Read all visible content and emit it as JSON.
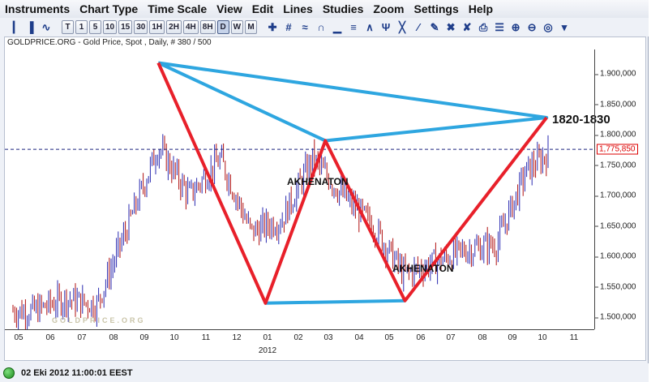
{
  "menu": [
    "Instruments",
    "Chart Type",
    "Time Scale",
    "View",
    "Edit",
    "Lines",
    "Studies",
    "Zoom",
    "Settings",
    "Help"
  ],
  "toolbar": {
    "timeframes": [
      "T",
      "1",
      "5",
      "10",
      "15",
      "30",
      "1H",
      "2H",
      "4H",
      "8H",
      "D",
      "W",
      "M"
    ],
    "active_timeframe": "D",
    "left_icons": [
      "bar-chart-icon",
      "candlestick-icon",
      "line-chart-icon"
    ],
    "right_icons": [
      "crosshair-icon",
      "grid-icon",
      "indicator-icon",
      "magnet-icon",
      "volume-bars-icon",
      "fibonacci-icon",
      "fan-icon",
      "andrews-pitchfork-icon",
      "gann-icon",
      "regression-icon",
      "pencil-tool-icon",
      "delete-icon",
      "erase-all-icon",
      "print-icon",
      "clipboard-icon",
      "zoom-in-icon",
      "zoom-out-icon",
      "zoom-reset-icon",
      "arrow-down-icon"
    ]
  },
  "chart": {
    "title": "GOLDPRICE.ORG - Gold Price, Spot , Daily, # 380 / 500",
    "watermark": "GOLDPRICE.ORG",
    "current_price": "1,775,850",
    "annotation_target": "1820-1830",
    "pattern_label_1": "AKHENATON",
    "pattern_label_2": "AKHENATON",
    "y_ticks": [
      "1.900,000",
      "1.850,000",
      "1.800,000",
      "1.750,000",
      "1.700,000",
      "1.650,000",
      "1.600,000",
      "1.550,000",
      "1.500,000"
    ],
    "x_ticks": [
      "05",
      "06",
      "07",
      "08",
      "09",
      "10",
      "11",
      "12",
      "01",
      "02",
      "03",
      "04",
      "05",
      "06",
      "07",
      "08",
      "09",
      "10",
      "11"
    ],
    "year_label": "2012",
    "colors": {
      "pattern_red": "#e8202a",
      "pattern_blue": "#2ea6e0",
      "bars_up": "#2a2ab0",
      "bars_down": "#b01010",
      "current_line": "#1a237e"
    }
  },
  "chart_data": {
    "type": "line",
    "title": "GOLDPRICE.ORG - Gold Price, Spot , Daily, # 380 / 500",
    "x": [
      "2011-05",
      "2011-06",
      "2011-07",
      "2011-08",
      "2011-09",
      "2011-10",
      "2011-11",
      "2011-12",
      "2012-01",
      "2012-02",
      "2012-03",
      "2012-04",
      "2012-05",
      "2012-06",
      "2012-07",
      "2012-08",
      "2012-09",
      "2012-10"
    ],
    "series": [
      {
        "values": [
          1510,
          1530,
          1520,
          1650,
          1780,
          1700,
          1760,
          1640,
          1660,
          1760,
          1700,
          1650,
          1570,
          1590,
          1610,
          1620,
          1740,
          1780
        ]
      }
    ],
    "patterns": {
      "red_zigzag": [
        {
          "x": "2011-09",
          "y": 1918
        },
        {
          "x": "2011-12-29",
          "y": 1523
        },
        {
          "x": "2012-02-28",
          "y": 1790
        },
        {
          "x": "2012-05-16",
          "y": 1527
        },
        {
          "x": "2012-10-05",
          "y": 1828
        }
      ],
      "blue_triangles": [
        [
          {
            "x": "2011-09",
            "y": 1918
          },
          {
            "x": "2012-02-28",
            "y": 1790
          },
          {
            "x": "2012-10-05",
            "y": 1828
          },
          {
            "x": "2011-09",
            "y": 1918
          }
        ],
        [
          {
            "x": "2011-12-29",
            "y": 1523
          },
          {
            "x": "2012-05-16",
            "y": 1527
          }
        ]
      ]
    },
    "current_price": 1775.85,
    "ylim": [
      1480,
      1940
    ],
    "xlabel": "2012",
    "ylabel": "",
    "grid": false
  }
}
